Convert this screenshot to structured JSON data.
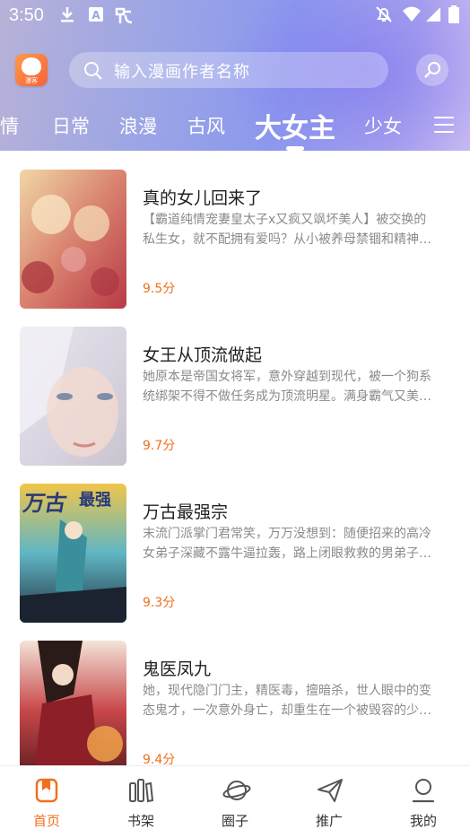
{
  "status_bar": {
    "time": "3:50",
    "left_icons": [
      "download-icon",
      "a-box-icon",
      "bug-icon"
    ],
    "right_icons": [
      "notifications-off-icon",
      "wifi-icon",
      "signal-icon",
      "battery-icon"
    ]
  },
  "app": {
    "logo_label": "漫客"
  },
  "search": {
    "placeholder": "输入漫画作者名称"
  },
  "tabs": [
    {
      "label": "情",
      "active": false
    },
    {
      "label": "日常",
      "active": false
    },
    {
      "label": "浪漫",
      "active": false
    },
    {
      "label": "古风",
      "active": false
    },
    {
      "label": "大女主",
      "active": true
    },
    {
      "label": "少女",
      "active": false
    }
  ],
  "comics": [
    {
      "title": "真的女儿回来了",
      "desc_line1": "【霸道纯情宠妻皇太子x又疯又飒坏美人】被交换的",
      "desc_line2": "私生女，就不配拥有爱吗？从小被养母禁锢和精神…",
      "score": "9.5分"
    },
    {
      "title": "女王从顶流做起",
      "desc_line1": "她原本是帝国女将军，意外穿越到现代，被一个狗系",
      "desc_line2": "统绑架不得不做任务成为顶流明星。满身霸气又美…",
      "score": "9.7分"
    },
    {
      "title": "万古最强宗",
      "desc_line1": "末流门派掌门君常笑，万万没想到：随便招来的高冷",
      "desc_line2": "女弟子深藏不露牛逼拉轰，路上闭眼救救的男弟子…",
      "score": "9.3分"
    },
    {
      "title": "鬼医凤九",
      "desc_line1": "她，现代隐门门主，精医毒，擅暗杀，世人眼中的变",
      "desc_line2": "态鬼才，一次意外身亡，却重生在一个被毁容的少…",
      "score": "9.4分"
    }
  ],
  "bottom_nav": [
    {
      "label": "首页",
      "icon": "bookmark-icon",
      "active": true
    },
    {
      "label": "书架",
      "icon": "bookshelf-icon",
      "active": false
    },
    {
      "label": "圈子",
      "icon": "planet-icon",
      "active": false
    },
    {
      "label": "推广",
      "icon": "paper-plane-icon",
      "active": false
    },
    {
      "label": "我的",
      "icon": "user-icon",
      "active": false
    }
  ],
  "colors": {
    "accent": "#f0701e",
    "header_gradient_start": "#b7b2d8",
    "header_gradient_mid": "#8c98ee"
  }
}
